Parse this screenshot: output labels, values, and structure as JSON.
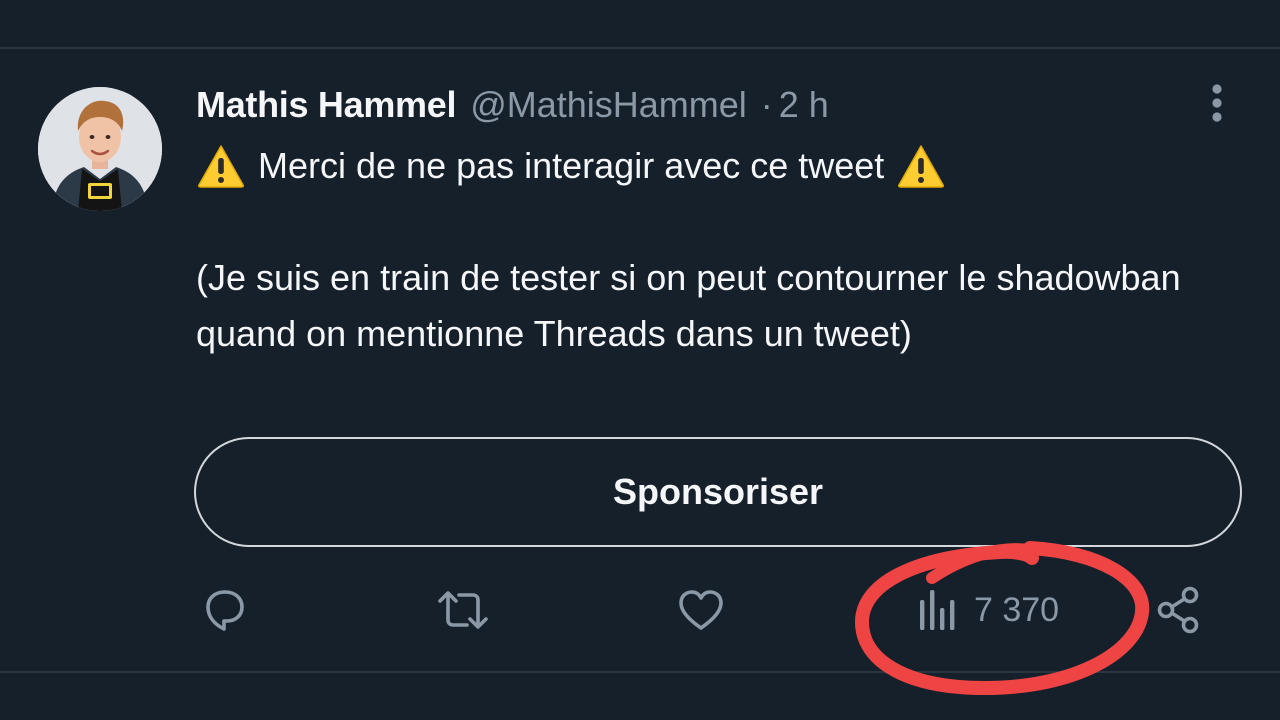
{
  "author": {
    "name": "Mathis Hammel",
    "handle": "@MathisHammel",
    "separator": "·",
    "time": "2 h",
    "avatar_icon": "profile-photo"
  },
  "tweet": {
    "line1": "Merci de ne pas interagir avec ce tweet",
    "line1_icon": "warning-sign-emoji",
    "body": "(Je suis en train de tester si on peut contourner le shadowban quand on mentionne Threads dans un tweet)"
  },
  "sponsor_button": {
    "label": "Sponsoriser"
  },
  "actions": {
    "reply_icon": "reply-icon",
    "retweet_icon": "retweet-icon",
    "like_icon": "heart-icon",
    "views_icon": "bar-chart-icon",
    "views_count": "7 370",
    "share_icon": "share-icon",
    "more_icon": "more-vertical-icon"
  },
  "colors": {
    "background": "#15202b",
    "text_primary": "#f4f6f8",
    "text_secondary": "#8b98a5",
    "annotation": "#ef4444",
    "warning": "#ffcc32"
  }
}
